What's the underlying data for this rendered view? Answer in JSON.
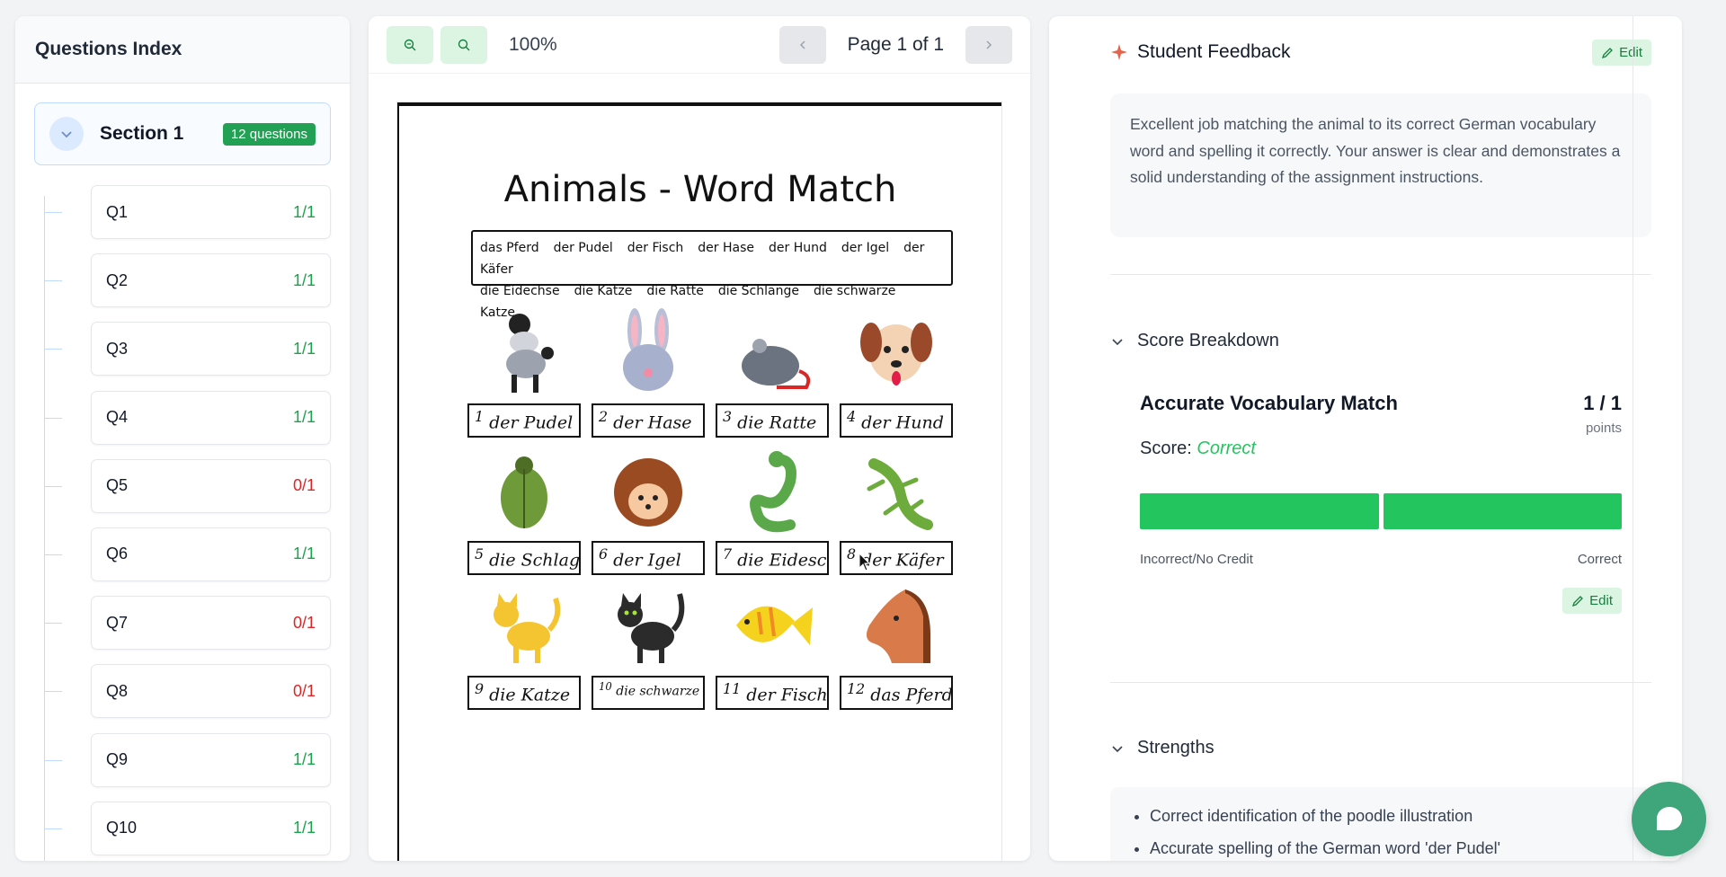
{
  "questions_index": {
    "title": "Questions Index",
    "section": {
      "title": "Section 1",
      "badge": "12 questions"
    },
    "questions": [
      {
        "label": "Q1",
        "score": "1/1",
        "status": "ok"
      },
      {
        "label": "Q2",
        "score": "1/1",
        "status": "ok"
      },
      {
        "label": "Q3",
        "score": "1/1",
        "status": "ok"
      },
      {
        "label": "Q4",
        "score": "1/1",
        "status": "ok"
      },
      {
        "label": "Q5",
        "score": "0/1",
        "status": "bad"
      },
      {
        "label": "Q6",
        "score": "1/1",
        "status": "ok"
      },
      {
        "label": "Q7",
        "score": "0/1",
        "status": "bad"
      },
      {
        "label": "Q8",
        "score": "0/1",
        "status": "bad"
      },
      {
        "label": "Q9",
        "score": "1/1",
        "status": "ok"
      },
      {
        "label": "Q10",
        "score": "1/1",
        "status": "ok"
      }
    ]
  },
  "viewer": {
    "zoom": "100%",
    "page_indicator": "Page 1 of 1",
    "document": {
      "title": "Animals - Word Match",
      "word_bank": [
        "das Pferd",
        "der Pudel",
        "der Fisch",
        "der Hase",
        "der Hund",
        "der Igel",
        "der Käfer",
        "die Eidechse",
        "die Katze",
        "die Ratte",
        "die Schlange",
        "die schwarze Katze"
      ],
      "answers": [
        {
          "num": "1",
          "text": "der Pudel",
          "animal": "poodle"
        },
        {
          "num": "2",
          "text": "der Hase",
          "animal": "rabbit"
        },
        {
          "num": "3",
          "text": "die Ratte",
          "animal": "rat"
        },
        {
          "num": "4",
          "text": "der Hund",
          "animal": "dog"
        },
        {
          "num": "5",
          "text": "die Schlage",
          "animal": "beetle"
        },
        {
          "num": "6",
          "text": "der Igel",
          "animal": "hedgehog"
        },
        {
          "num": "7",
          "text": "die Eidesche",
          "animal": "snake"
        },
        {
          "num": "8",
          "text": "der Käfer",
          "animal": "lizard"
        },
        {
          "num": "9",
          "text": "die Katze",
          "animal": "yellow-cat"
        },
        {
          "num": "10",
          "text": "die schwarze Katze",
          "animal": "black-cat"
        },
        {
          "num": "11",
          "text": "der Fisch",
          "animal": "fish"
        },
        {
          "num": "12",
          "text": "das Pferd",
          "animal": "horse"
        }
      ]
    }
  },
  "feedback": {
    "title": "Student Feedback",
    "edit_label": "Edit",
    "text": "Excellent job matching the animal to its correct German vocabulary word and spelling it correctly. Your answer is clear and demonstrates a solid understanding of the assignment instructions.",
    "score_breakdown": {
      "heading": "Score Breakdown",
      "criterion": "Accurate Vocabulary Match",
      "points": "1 / 1",
      "points_unit": "points",
      "score_label": "Score:",
      "score_value": "Correct",
      "scale_left": "Incorrect/No Credit",
      "scale_right": "Correct",
      "edit_label": "Edit"
    },
    "strengths": {
      "heading": "Strengths",
      "items": [
        "Correct identification of the poodle illustration",
        "Accurate spelling of the German word 'der Pudel'"
      ]
    }
  },
  "colors": {
    "accent_green": "#22c55e",
    "badge_green": "#22a155",
    "error_red": "#dc2626",
    "chat_button": "#3fa57a"
  }
}
